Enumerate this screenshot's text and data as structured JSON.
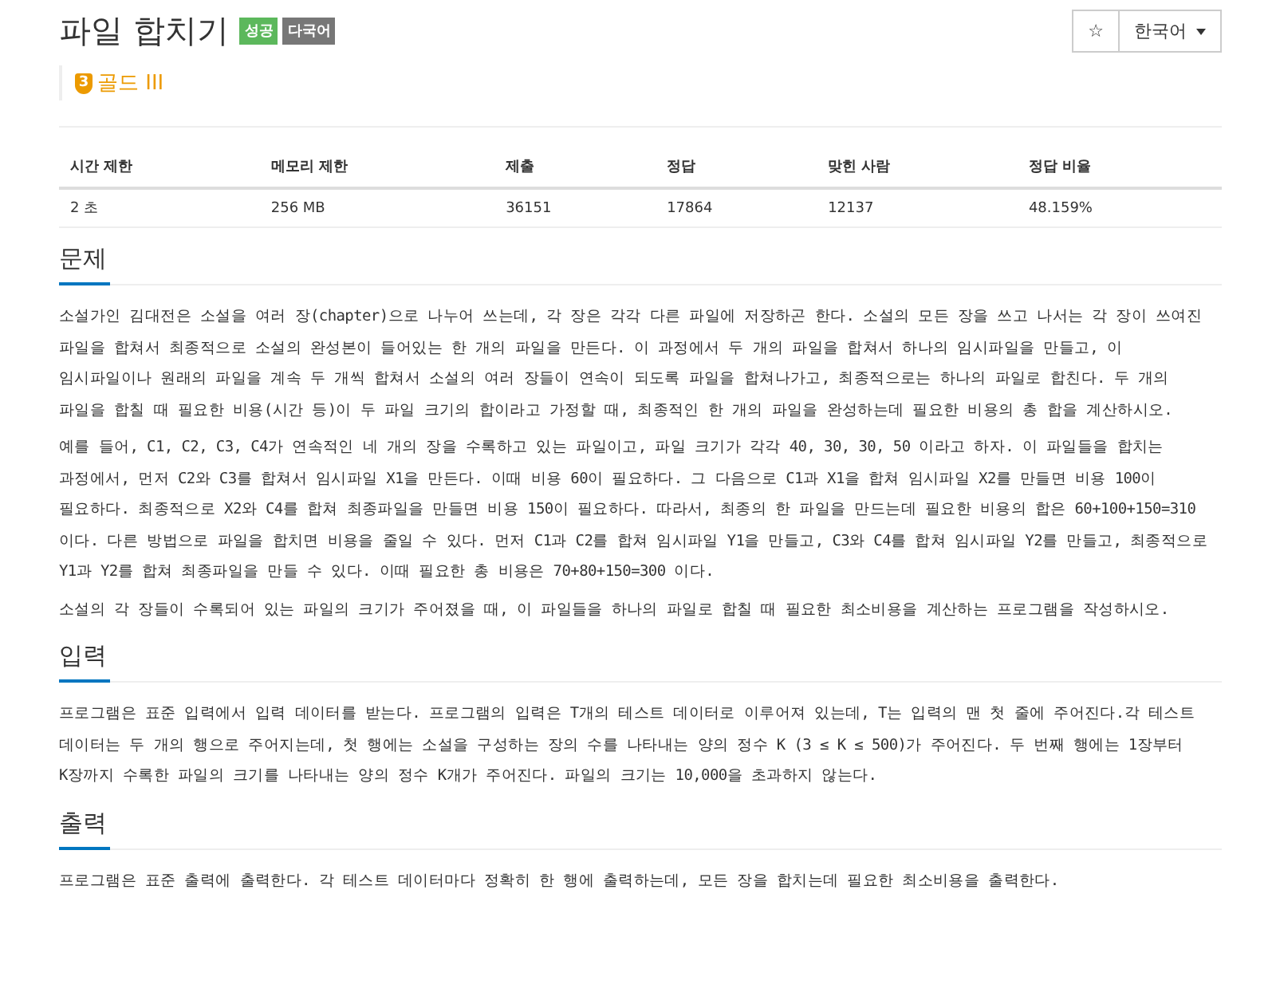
{
  "title": "파일 합치기",
  "labels": [
    {
      "text": "성공",
      "color": "#5cb85c"
    },
    {
      "text": "다국어",
      "color": "#777777"
    }
  ],
  "tier": {
    "level": "3",
    "name": "골드 III"
  },
  "header_buttons": {
    "star": "☆",
    "language": "한국어"
  },
  "table": {
    "columns": [
      "시간 제한",
      "메모리 제한",
      "제출",
      "정답",
      "맞힌 사람",
      "정답 비율"
    ],
    "rows": [
      [
        "2 초",
        "256 MB",
        "36151",
        "17864",
        "12137",
        "48.159%"
      ]
    ]
  },
  "sections": [
    {
      "heading": "문제",
      "paragraphs": [
        "소설가인 김대전은 소설을 여러 장(chapter)으로 나누어 쓰는데, 각 장은 각각 다른 파일에 저장하곤 한다. 소설의 모든 장을 쓰고 나서는 각 장이 쓰여진 파일을 합쳐서 최종적으로 소설의 완성본이 들어있는 한 개의 파일을 만든다. 이 과정에서 두 개의 파일을 합쳐서 하나의 임시파일을 만들고, 이 임시파일이나 원래의 파일을 계속 두 개씩 합쳐서 소설의 여러 장들이 연속이 되도록 파일을 합쳐나가고, 최종적으로는 하나의 파일로 합친다. 두 개의 파일을 합칠 때 필요한 비용(시간 등)이 두 파일 크기의 합이라고 가정할 때, 최종적인 한 개의 파일을 완성하는데 필요한 비용의 총 합을 계산하시오.",
        "예를 들어, C1, C2, C3, C4가 연속적인 네 개의 장을 수록하고 있는 파일이고, 파일 크기가 각각 40, 30, 30, 50 이라고 하자. 이 파일들을 합치는 과정에서, 먼저 C2와 C3를 합쳐서 임시파일 X1을 만든다. 이때 비용 60이 필요하다. 그 다음으로 C1과 X1을 합쳐 임시파일 X2를 만들면 비용 100이 필요하다. 최종적으로 X2와 C4를 합쳐 최종파일을 만들면 비용 150이 필요하다. 따라서, 최종의 한 파일을 만드는데 필요한 비용의 합은 60+100+150=310 이다. 다른 방법으로 파일을 합치면 비용을 줄일 수 있다. 먼저 C1과 C2를 합쳐 임시파일 Y1을 만들고, C3와 C4를 합쳐 임시파일 Y2를 만들고, 최종적으로 Y1과 Y2를 합쳐 최종파일을 만들 수 있다. 이때 필요한 총 비용은 70+80+150=300 이다.",
        "소설의 각 장들이 수록되어 있는 파일의 크기가 주어졌을 때, 이 파일들을 하나의 파일로 합칠 때 필요한 최소비용을 계산하는 프로그램을 작성하시오."
      ]
    },
    {
      "heading": "입력",
      "paragraphs": [
        "프로그램은 표준 입력에서 입력 데이터를 받는다. 프로그램의 입력은 T개의 테스트 데이터로 이루어져 있는데, T는 입력의 맨 첫 줄에 주어진다.각 테스트 데이터는 두 개의 행으로 주어지는데, 첫 행에는 소설을 구성하는 장의 수를 나타내는 양의 정수 K (3 ≤ K ≤ 500)가 주어진다. 두 번째 행에는 1장부터 K장까지 수록한 파일의 크기를 나타내는 양의 정수 K개가 주어진다. 파일의 크기는 10,000을 초과하지 않는다."
      ]
    },
    {
      "heading": "출력",
      "paragraphs": [
        "프로그램은 표준 출력에 출력한다. 각 테스트 데이터마다 정확히 한 행에 출력하는데, 모든 장을 합치는데 필요한 최소비용을 출력한다."
      ]
    }
  ]
}
